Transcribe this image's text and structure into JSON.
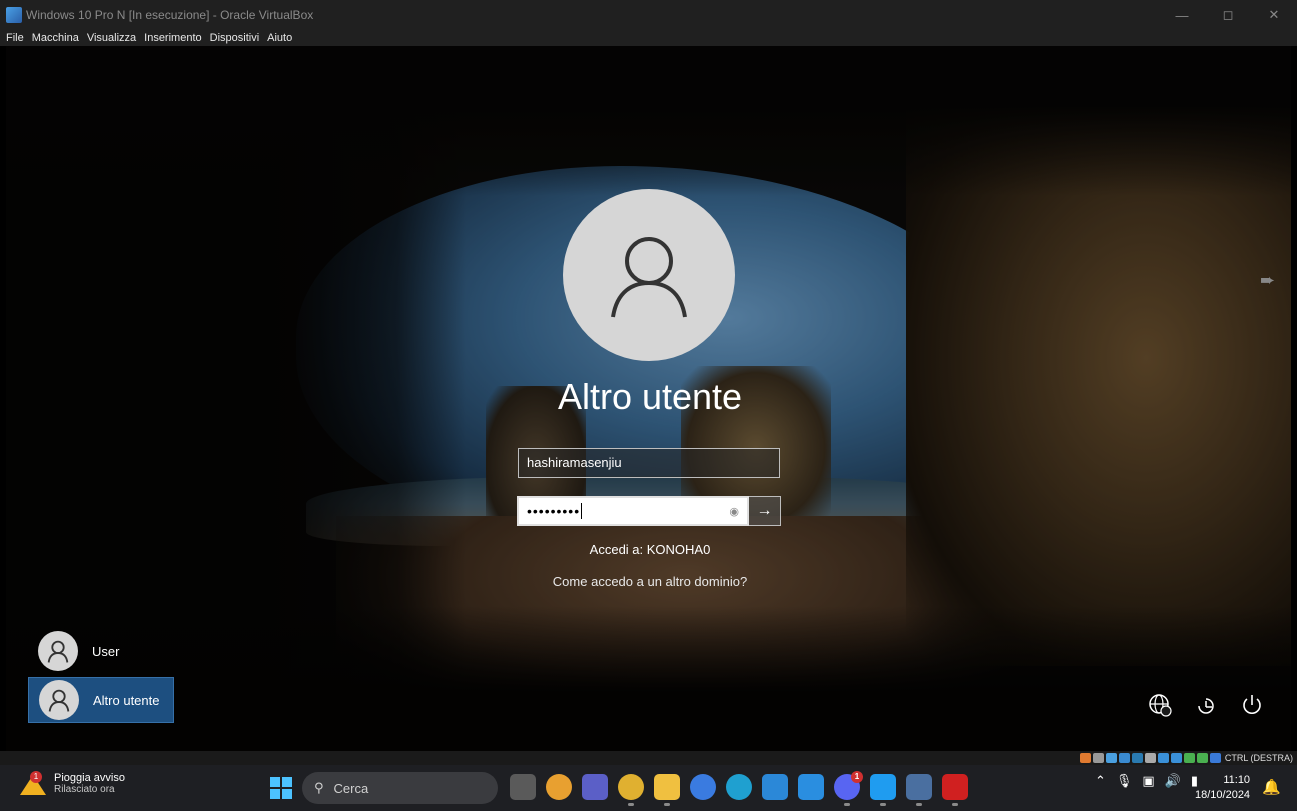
{
  "vbox": {
    "window_title": "Windows 10 Pro N [In esecuzione] - Oracle VirtualBox",
    "menu": [
      "File",
      "Macchina",
      "Visualizza",
      "Inserimento",
      "Dispositivi",
      "Aiuto"
    ],
    "status_host_key": "CTRL (DESTRA)"
  },
  "login": {
    "user_name": "Altro utente",
    "username_value": "hashiramasenjiu",
    "password_mask": "•••••••••",
    "sign_in_to": "Accedi a: KONOHA0",
    "other_domain_link": "Come accedo a un altro dominio?"
  },
  "user_list": [
    {
      "label": "User",
      "selected": false
    },
    {
      "label": "Altro utente",
      "selected": true
    }
  ],
  "corner_icons": [
    "network-icon",
    "accessibility-icon",
    "power-icon"
  ],
  "taskbar": {
    "weather_title": "Pioggia avviso",
    "weather_subtitle": "Rilasciato ora",
    "weather_badge": "1",
    "search_placeholder": "Cerca",
    "clock_time": "11:10",
    "clock_date": "18/10/2024",
    "apps": [
      {
        "name": "task-view-icon",
        "color": "#5a5a5a"
      },
      {
        "name": "media-app-icon",
        "color": "#e8a030"
      },
      {
        "name": "teams-icon",
        "color": "#5b5fc7"
      },
      {
        "name": "chrome-icon",
        "color": "#e0b030"
      },
      {
        "name": "file-explorer-icon",
        "color": "#f0c040"
      },
      {
        "name": "app-icon",
        "color": "#3a7be0"
      },
      {
        "name": "edge-icon",
        "color": "#1fa0d0"
      },
      {
        "name": "store-icon",
        "color": "#2b88d8"
      },
      {
        "name": "app-icon",
        "color": "#2a8ee0"
      },
      {
        "name": "discord-icon",
        "color": "#5865f2",
        "badge": "1"
      },
      {
        "name": "vscode-icon",
        "color": "#1f9cf0"
      },
      {
        "name": "app-icon",
        "color": "#4a6fa0"
      },
      {
        "name": "acrobat-icon",
        "color": "#d02020"
      }
    ]
  }
}
